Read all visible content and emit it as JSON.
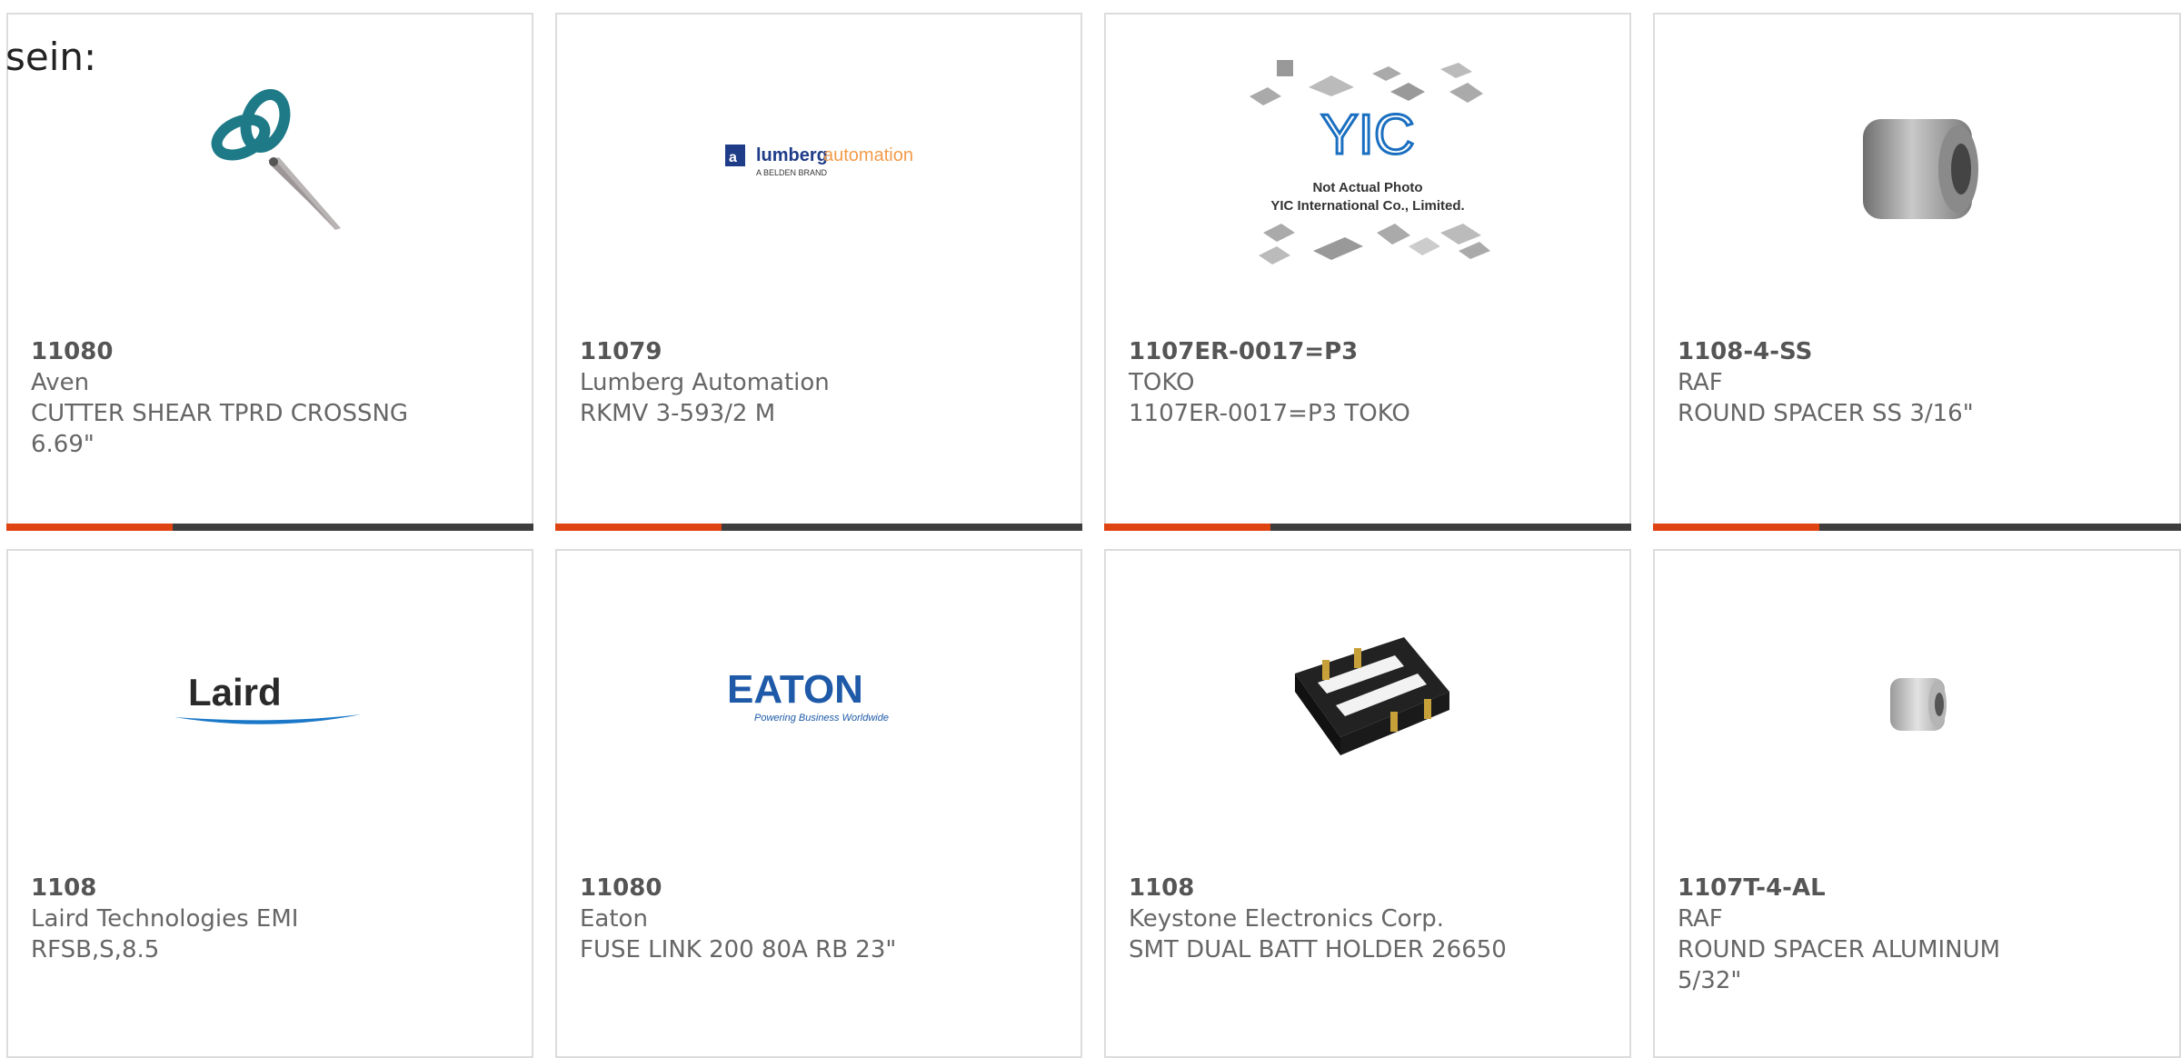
{
  "heading": "sein:",
  "colors": {
    "accent": "#e04312",
    "bar": "#3d3d3d",
    "border": "#dcdcdc",
    "text": "#666666"
  },
  "cards": [
    {
      "part": "11080",
      "lines": [
        "Aven",
        "CUTTER SHEAR TPRD CROSSNG",
        "6.69\""
      ],
      "image": "scissors-photo"
    },
    {
      "part": "11079",
      "lines": [
        "Lumberg Automation",
        "RKMV 3-593/2 M"
      ],
      "image": "lumberg-automation-logo",
      "logo": {
        "brand": "lumberg",
        "brand2": "automation",
        "tag": "A BELDEN BRAND"
      }
    },
    {
      "part": "1107ER-0017=P3",
      "lines": [
        "TOKO",
        "1107ER-0017=P3 TOKO"
      ],
      "image": "yic-placeholder",
      "logo": {
        "mark": "YIC",
        "line1": "Not Actual Photo",
        "line2": "YIC International Co., Limited."
      }
    },
    {
      "part": "1108-4-SS",
      "lines": [
        "RAF",
        "ROUND SPACER SS 3/16\""
      ],
      "image": "steel-spacer-photo"
    },
    {
      "part": "1108",
      "lines": [
        "Laird Technologies EMI",
        "RFSB,S,8.5"
      ],
      "image": "laird-logo",
      "logo": {
        "brand": "Laird"
      }
    },
    {
      "part": "11080",
      "lines": [
        "Eaton",
        "FUSE LINK 200 80A RB 23\""
      ],
      "image": "eaton-logo",
      "logo": {
        "brand": "EATON",
        "tag": "Powering Business Worldwide"
      }
    },
    {
      "part": "1108",
      "lines": [
        "Keystone Electronics Corp.",
        "SMT DUAL BATT HOLDER 26650"
      ],
      "image": "battery-holder-photo"
    },
    {
      "part": "1107T-4-AL",
      "lines": [
        "RAF",
        "ROUND SPACER ALUMINUM",
        "5/32\""
      ],
      "image": "aluminum-spacer-photo"
    }
  ]
}
